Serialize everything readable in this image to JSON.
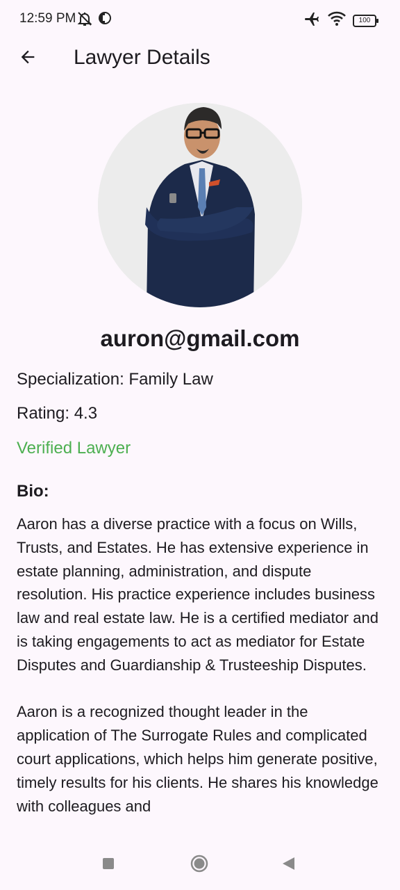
{
  "status_bar": {
    "time": "12:59 PM",
    "battery": "100",
    "icons": [
      "do-not-disturb-icon",
      "app-notification-icon",
      "airplane-icon",
      "wifi-icon",
      "battery-icon"
    ]
  },
  "app_bar": {
    "title": "Lawyer Details",
    "back_icon": "arrow-back-icon"
  },
  "profile": {
    "email": "auron@gmail.com",
    "specialization": "Specialization: Family Law",
    "rating": "Rating: 4.3",
    "verified": "Verified Lawyer",
    "bio_title": "Bio:",
    "bio_paragraph_1": "Aaron has a diverse practice with a focus on Wills, Trusts, and Estates. He has extensive experience in estate planning, administration, and dispute resolution. His practice experience includes business law and real estate law. He is a certified mediator and is taking engagements to act as mediator for Estate Disputes and Guardianship & Trusteeship Disputes.",
    "bio_paragraph_2": "Aaron is a recognized thought leader in the application of The Surrogate Rules and complicated court applications, which helps him generate positive, timely results for his clients. He shares his knowledge with colleagues and"
  },
  "colors": {
    "background": "#fdf7fd",
    "verified": "#4caf50",
    "text": "#1d1b20"
  },
  "nav_bar": {
    "icons": [
      "recents-square-icon",
      "home-circle-icon",
      "back-triangle-icon"
    ]
  }
}
